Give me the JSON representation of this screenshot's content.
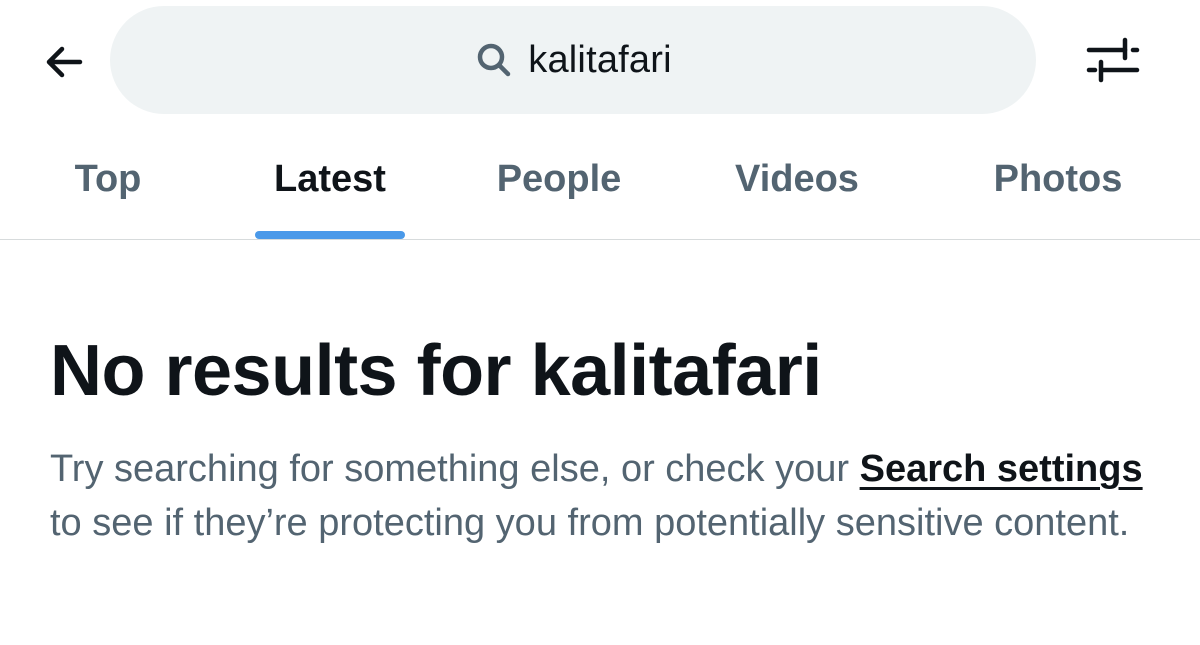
{
  "header": {
    "back_icon": "arrow-left-icon",
    "search": {
      "icon": "search-icon",
      "value": "kalitafari"
    },
    "filter_icon": "sliders-icon"
  },
  "tabs": [
    {
      "label": "Top",
      "active": false
    },
    {
      "label": "Latest",
      "active": true
    },
    {
      "label": "People",
      "active": false
    },
    {
      "label": "Videos",
      "active": false
    },
    {
      "label": "Photos",
      "active": false
    }
  ],
  "empty_state": {
    "title": "No results for kalitafari",
    "body_before": "Try searching for something else, or check your ",
    "link_label": "Search settings",
    "body_after": " to see if they’re protecting you from potentially sensitive content."
  },
  "colors": {
    "accent": "#1d9bf0",
    "text_primary": "#0f1419",
    "text_secondary": "#536471",
    "search_bg": "#eff3f4"
  }
}
